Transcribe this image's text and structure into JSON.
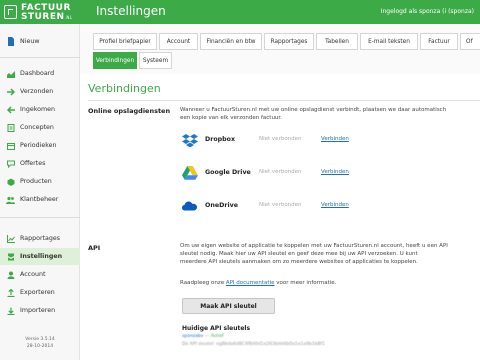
{
  "app": {
    "logo_line1": "FACTUUR",
    "logo_line2": "STUREN",
    "logo_suffix": ".NL",
    "page_heading": "Instellingen",
    "user_info": "Ingelogd als sponza (i (sponza)"
  },
  "sidebar": {
    "new_label": "Nieuw",
    "items_group1": [
      {
        "label": "Dashboard",
        "icon": "dashboard-icon"
      },
      {
        "label": "Verzonden",
        "icon": "send-icon"
      },
      {
        "label": "Ingekomen",
        "icon": "inbox-icon"
      },
      {
        "label": "Concepten",
        "icon": "draft-icon"
      },
      {
        "label": "Periodieken",
        "icon": "calendar-icon"
      },
      {
        "label": "Offertes",
        "icon": "quote-icon"
      },
      {
        "label": "Producten",
        "icon": "product-icon"
      },
      {
        "label": "Klantbeheer",
        "icon": "customers-icon"
      }
    ],
    "items_group2": [
      {
        "label": "Rapportages",
        "icon": "report-icon"
      },
      {
        "label": "Instellingen",
        "icon": "settings-icon",
        "active": true
      },
      {
        "label": "Account",
        "icon": "account-icon"
      },
      {
        "label": "Exporteren",
        "icon": "export-icon"
      },
      {
        "label": "Importeren",
        "icon": "import-icon"
      }
    ],
    "version": "Versie 3.5.14",
    "version_date": "28-10-2014"
  },
  "tabs": {
    "row1": [
      "Profiel briefpapier",
      "Account",
      "Financiën en btw",
      "Rapportages",
      "Tabellen",
      "E-mail teksten",
      "Factuur",
      "Of"
    ],
    "row2": [
      "Verbindingen",
      "Systeem"
    ],
    "active": "Verbindingen"
  },
  "main": {
    "title": "Verbindingen",
    "online": {
      "label": "Online opslagdiensten",
      "description_line1": "Wanneer u FactuurSturen.nl met uw online opslagdienst verbindt, plaatsen we daar automatisch",
      "description_line2": "een kopie van elk verzonden factuur.",
      "services": [
        {
          "name": "Dropbox",
          "status": "Niet verbonden",
          "action": "Verbinden",
          "icon": "dropbox-icon"
        },
        {
          "name": "Google Drive",
          "status": "Niet verbonden",
          "action": "Verbinden",
          "icon": "google-drive-icon"
        },
        {
          "name": "OneDrive",
          "status": "Niet verbonden",
          "action": "Verbinden",
          "icon": "onedrive-icon"
        }
      ]
    },
    "api": {
      "label": "API",
      "description_line1": "Om uw eigen website of applicatie te koppelen met uw FactuurSturen.nl account, heeft u een API",
      "description_line2": "sleutel nodig. Maak hier uw API sleutel en geef deze mee bij uw API verzoeken. U kunt",
      "description_line3": "meerdere API sleutels aanmaken om zo meerdere websites of applicaties te koppelen.",
      "docs_prefix": "Raadpleeg onze ",
      "docs_link": "API documentatie",
      "docs_suffix": " voor meer informatie.",
      "button": "Maak API sleutel",
      "keys_title": "Huidige API sleutels",
      "key_name": "sponzabv",
      "key_status": "Actief",
      "key_value": "De API sleutel: eg8bda6d8C4f8d0d1e263bdd4b0a1e1a9b1b8f1"
    }
  }
}
